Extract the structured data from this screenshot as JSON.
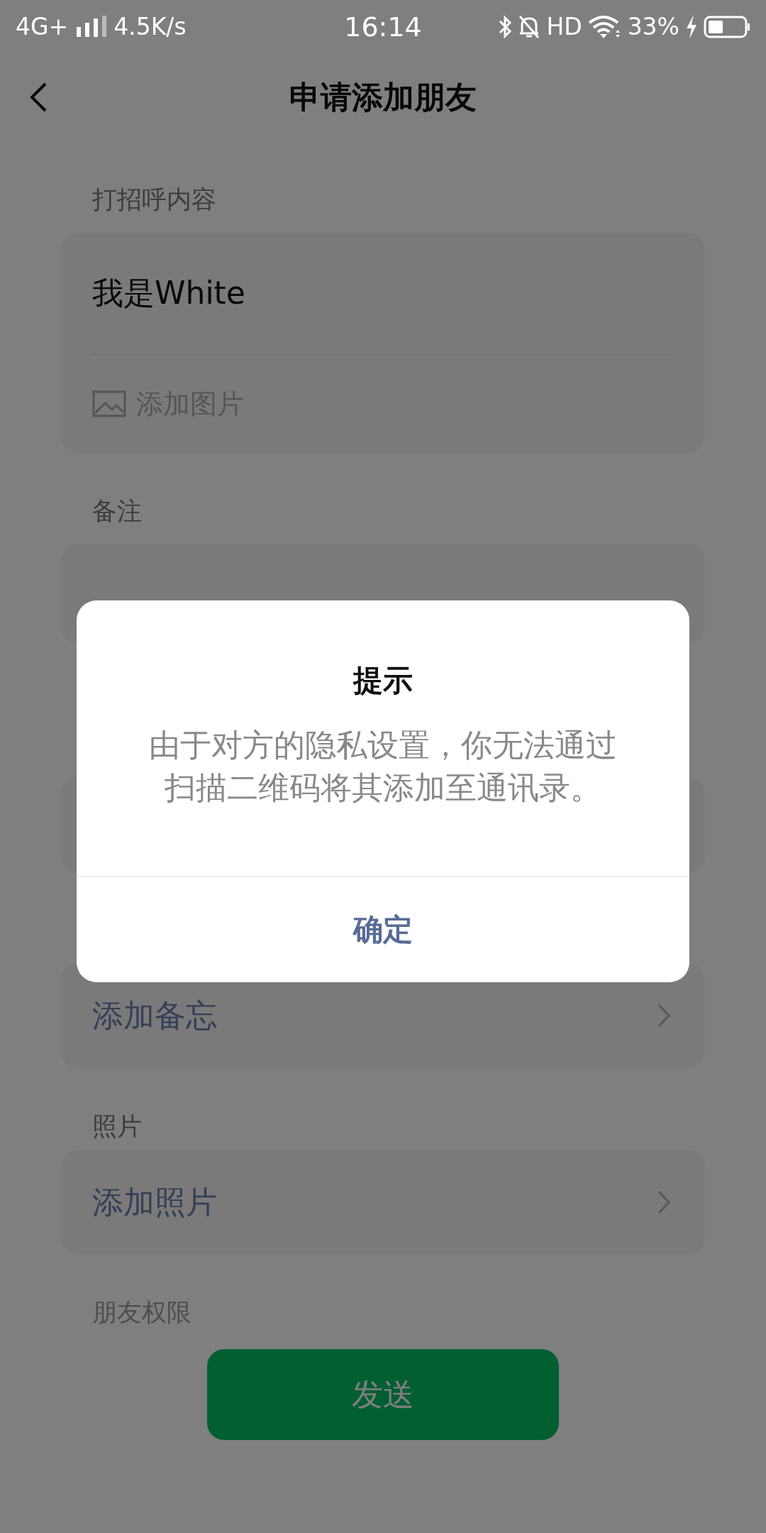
{
  "status_bar": {
    "network": "4G+",
    "speed": "4.5K/s",
    "time": "16:14",
    "hd": "HD",
    "battery": "33%"
  },
  "header": {
    "title": "申请添加朋友"
  },
  "greeting": {
    "label": "打招呼内容",
    "value": "我是White",
    "add_image": "添加图片"
  },
  "remark": {
    "label": "备注"
  },
  "memo": {
    "text": "添加备忘"
  },
  "photos": {
    "label": "照片",
    "text": "添加照片"
  },
  "permissions": {
    "label": "朋友权限"
  },
  "send_button": {
    "label": "发送"
  },
  "dialog": {
    "title": "提示",
    "message": "由于对方的隐私设置，你无法通过扫描二维码将其添加至通讯录。",
    "button": "确定"
  }
}
